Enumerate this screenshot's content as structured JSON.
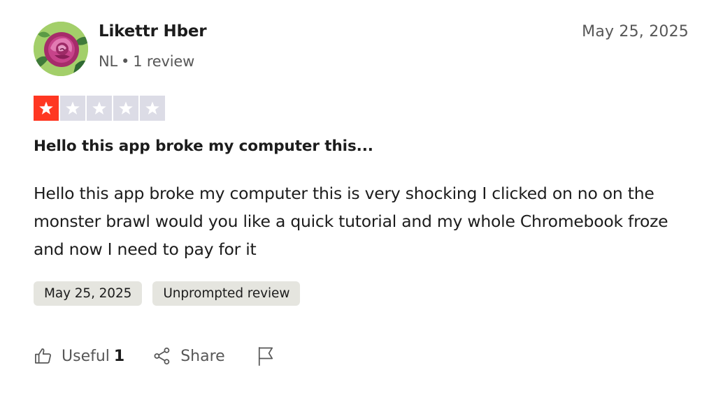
{
  "reviewer": {
    "name": "Likettr Hber",
    "country": "NL",
    "separator": "•",
    "review_count": "1 review",
    "avatar": "rose-photo"
  },
  "review": {
    "header_date": "May 25, 2025",
    "rating": 1,
    "rating_max": 5,
    "star_filled_color": "#ff3722",
    "star_empty_color": "#dcdce6",
    "title": "Hello this app broke my computer this...",
    "body": "Hello this app broke my computer this is very shocking I clicked on no on the monster brawl would you like a quick tutorial and my whole Chromebook froze and now I need to pay for it",
    "chips": [
      "May 25, 2025",
      "Unprompted review"
    ]
  },
  "actions": {
    "useful_label": "Useful",
    "useful_count": "1",
    "share_label": "Share",
    "icons": [
      "thumbs-up-icon",
      "share-icon",
      "flag-icon"
    ]
  }
}
